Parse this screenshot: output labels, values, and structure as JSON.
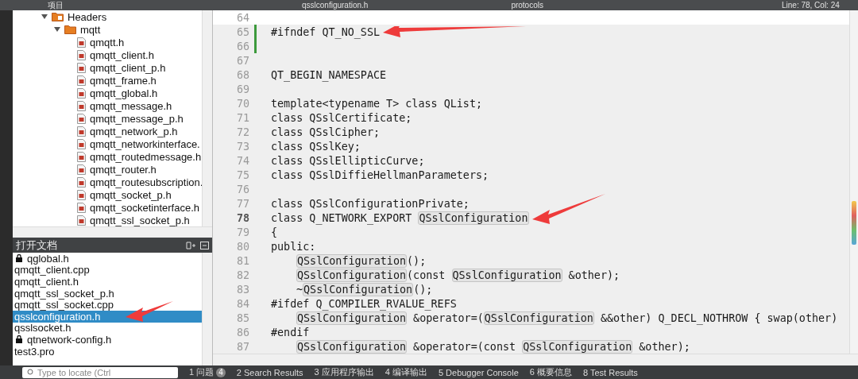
{
  "top_bar": {
    "panel_title": "项目",
    "file_tab": "qsslconfiguration.h",
    "symbol": "protocols",
    "position": "Line: 78, Col: 24"
  },
  "project_tree": [
    {
      "label": "Headers",
      "kind": "header-folder",
      "expanded": true,
      "children": [
        {
          "label": "mqtt",
          "kind": "folder",
          "expanded": true,
          "children": [
            {
              "label": "qmqtt.h",
              "kind": "header"
            },
            {
              "label": "qmqtt_client.h",
              "kind": "header"
            },
            {
              "label": "qmqtt_client_p.h",
              "kind": "header"
            },
            {
              "label": "qmqtt_frame.h",
              "kind": "header"
            },
            {
              "label": "qmqtt_global.h",
              "kind": "header"
            },
            {
              "label": "qmqtt_message.h",
              "kind": "header"
            },
            {
              "label": "qmqtt_message_p.h",
              "kind": "header"
            },
            {
              "label": "qmqtt_network_p.h",
              "kind": "header"
            },
            {
              "label": "qmqtt_networkinterface.",
              "kind": "header"
            },
            {
              "label": "qmqtt_routedmessage.h",
              "kind": "header"
            },
            {
              "label": "qmqtt_router.h",
              "kind": "header"
            },
            {
              "label": "qmqtt_routesubscription.",
              "kind": "header"
            },
            {
              "label": "qmqtt_socket_p.h",
              "kind": "header"
            },
            {
              "label": "qmqtt_socketinterface.h",
              "kind": "header"
            },
            {
              "label": "qmqtt_ssl_socket_p.h",
              "kind": "header"
            }
          ]
        }
      ]
    }
  ],
  "open_documents": {
    "title": "打开文档",
    "items": [
      {
        "label": "qglobal.h",
        "locked": true,
        "selected": false,
        "arrow": false
      },
      {
        "label": "qmqtt_client.cpp",
        "locked": false,
        "selected": false,
        "arrow": false
      },
      {
        "label": "qmqtt_client.h",
        "locked": false,
        "selected": false,
        "arrow": false
      },
      {
        "label": "qmqtt_ssl_socket_p.h",
        "locked": false,
        "selected": false,
        "arrow": false
      },
      {
        "label": "qmqtt_ssl_socket.cpp",
        "locked": false,
        "selected": false,
        "arrow": false
      },
      {
        "label": "qsslconfiguration.h",
        "locked": false,
        "selected": true,
        "arrow": true
      },
      {
        "label": "qsslsocket.h",
        "locked": false,
        "selected": false,
        "arrow": false
      },
      {
        "label": "qtnetwork-config.h",
        "locked": true,
        "selected": false,
        "arrow": false
      },
      {
        "label": "test3.pro",
        "locked": false,
        "selected": false,
        "arrow": false
      }
    ]
  },
  "locator": {
    "placeholder": "Type to locate (Ctrl"
  },
  "output_tabs": [
    {
      "label": "1 问题",
      "count": "4"
    },
    {
      "label": "2 Search Results"
    },
    {
      "label": "3 应用程序输出"
    },
    {
      "label": "4 编译输出"
    },
    {
      "label": "5 Debugger Console"
    },
    {
      "label": "6 概要信息"
    },
    {
      "label": "8 Test Results"
    }
  ],
  "editor": {
    "lines": [
      {
        "number": "64",
        "current": false,
        "modified": false,
        "arrow": false
      },
      {
        "number": "65",
        "current": false,
        "modified": true,
        "arrow": true,
        "indent": false,
        "segments": [
          {
            "kind": "code",
            "text": "#ifndef QT_NO_SSL"
          }
        ]
      },
      {
        "number": "66",
        "current": false,
        "modified": true,
        "arrow": false
      },
      {
        "number": "67",
        "current": false,
        "modified": false,
        "arrow": false
      },
      {
        "number": "68",
        "current": false,
        "modified": false,
        "arrow": false,
        "indent": false,
        "segments": [
          {
            "kind": "code",
            "text": "QT_BEGIN_NAMESPACE"
          }
        ]
      },
      {
        "number": "69",
        "current": false,
        "modified": false,
        "arrow": false
      },
      {
        "number": "70",
        "current": false,
        "modified": false,
        "arrow": false,
        "indent": false,
        "segments": [
          {
            "kind": "code",
            "text": "template<typename T> class QList;"
          }
        ]
      },
      {
        "number": "71",
        "current": false,
        "modified": false,
        "arrow": false,
        "indent": false,
        "segments": [
          {
            "kind": "code",
            "text": "class QSslCertificate;"
          }
        ]
      },
      {
        "number": "72",
        "current": false,
        "modified": false,
        "arrow": false,
        "indent": false,
        "segments": [
          {
            "kind": "code",
            "text": "class QSslCipher;"
          }
        ]
      },
      {
        "number": "73",
        "current": false,
        "modified": false,
        "arrow": false,
        "indent": false,
        "segments": [
          {
            "kind": "code",
            "text": "class QSslKey;"
          }
        ]
      },
      {
        "number": "74",
        "current": false,
        "modified": false,
        "arrow": false,
        "indent": false,
        "segments": [
          {
            "kind": "code",
            "text": "class QSslEllipticCurve;"
          }
        ]
      },
      {
        "number": "75",
        "current": false,
        "modified": false,
        "arrow": false,
        "indent": false,
        "segments": [
          {
            "kind": "code",
            "text": "class QSslDiffieHellmanParameters;"
          }
        ]
      },
      {
        "number": "76",
        "current": false,
        "modified": false,
        "arrow": false
      },
      {
        "number": "77",
        "current": false,
        "modified": false,
        "arrow": false,
        "indent": false,
        "segments": [
          {
            "kind": "code",
            "text": "class QSslConfigurationPrivate;"
          }
        ]
      },
      {
        "number": "78",
        "current": true,
        "modified": false,
        "arrow": true,
        "indent": false,
        "segments": [
          {
            "kind": "code",
            "text": "class Q_NETWORK_EXPORT "
          },
          {
            "kind": "ref",
            "text": "QSslConfiguration"
          }
        ]
      },
      {
        "number": "79",
        "current": false,
        "modified": false,
        "arrow": false,
        "indent": false,
        "segments": [
          {
            "kind": "code",
            "text": "{"
          }
        ]
      },
      {
        "number": "80",
        "current": false,
        "modified": false,
        "arrow": false,
        "indent": false,
        "segments": [
          {
            "kind": "code",
            "text": "public:"
          }
        ]
      },
      {
        "number": "81",
        "current": false,
        "modified": false,
        "arrow": false,
        "indent": true,
        "segments": [
          {
            "kind": "ref",
            "text": "QSslConfiguration"
          },
          {
            "kind": "code",
            "text": "();"
          }
        ]
      },
      {
        "number": "82",
        "current": false,
        "modified": false,
        "arrow": false,
        "indent": true,
        "segments": [
          {
            "kind": "ref",
            "text": "QSslConfiguration"
          },
          {
            "kind": "code",
            "text": "(const "
          },
          {
            "kind": "ref",
            "text": "QSslConfiguration"
          },
          {
            "kind": "code",
            "text": " &other);"
          }
        ]
      },
      {
        "number": "83",
        "current": false,
        "modified": false,
        "arrow": false,
        "indent": true,
        "segments": [
          {
            "kind": "code",
            "text": "~"
          },
          {
            "kind": "ref",
            "text": "QSslConfiguration"
          },
          {
            "kind": "code",
            "text": "();"
          }
        ]
      },
      {
        "number": "84",
        "current": false,
        "modified": false,
        "arrow": false,
        "indent": false,
        "segments": [
          {
            "kind": "code",
            "text": "#ifdef Q_COMPILER_RVALUE_REFS"
          }
        ]
      },
      {
        "number": "85",
        "current": false,
        "modified": false,
        "arrow": false,
        "indent": true,
        "segments": [
          {
            "kind": "ref",
            "text": "QSslConfiguration"
          },
          {
            "kind": "code",
            "text": " &operator=("
          },
          {
            "kind": "ref",
            "text": "QSslConfiguration"
          },
          {
            "kind": "code",
            "text": " &&other) Q_DECL_NOTHROW { swap(other)"
          }
        ]
      },
      {
        "number": "86",
        "current": false,
        "modified": false,
        "arrow": false,
        "indent": false,
        "segments": [
          {
            "kind": "code",
            "text": "#endif"
          }
        ]
      },
      {
        "number": "87",
        "current": false,
        "modified": false,
        "arrow": false,
        "indent": true,
        "segments": [
          {
            "kind": "ref",
            "text": "QSslConfiguration"
          },
          {
            "kind": "code",
            "text": " &operator=(const "
          },
          {
            "kind": "ref",
            "text": "QSslConfiguration"
          },
          {
            "kind": "code",
            "text": " &other);"
          }
        ]
      }
    ]
  }
}
